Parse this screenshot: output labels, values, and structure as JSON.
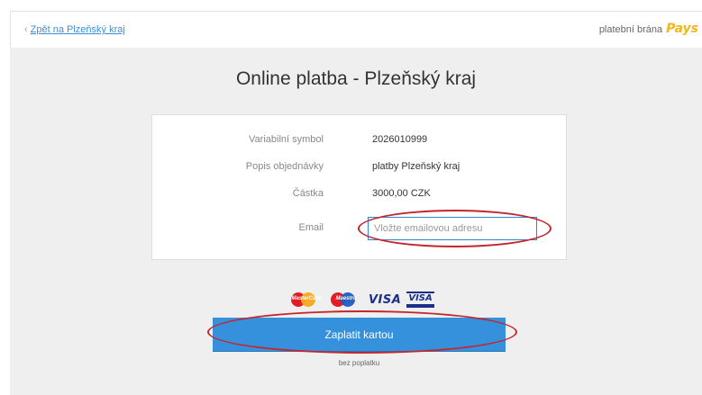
{
  "header": {
    "back_link": "Zpět na Plzeňský kraj",
    "back_chevron": "‹",
    "brand_prefix": "platební brána",
    "brand_logo": "Pays"
  },
  "page_title": "Online platba - Plzeňský kraj",
  "details": {
    "rows": [
      {
        "label": "Variabilní symbol",
        "value": "2026010999"
      },
      {
        "label": "Popis objednávky",
        "value": "platby Plzeňský kraj"
      },
      {
        "label": "Částka",
        "value": "3000,00 CZK"
      }
    ],
    "email_label": "Email",
    "email_placeholder": "Vložte emailovou adresu",
    "email_value": ""
  },
  "card_logos": {
    "mastercard": "MasterCard",
    "maestro": "Maestro",
    "visa": "VISA",
    "visa_electron": "VISA"
  },
  "pay_button": "Zaplatit kartou",
  "fee_note": "bez poplatku",
  "colors": {
    "accent": "#3591dc",
    "annotation": "#c4262e",
    "brand": "#f5b51b",
    "background": "#efefef"
  }
}
